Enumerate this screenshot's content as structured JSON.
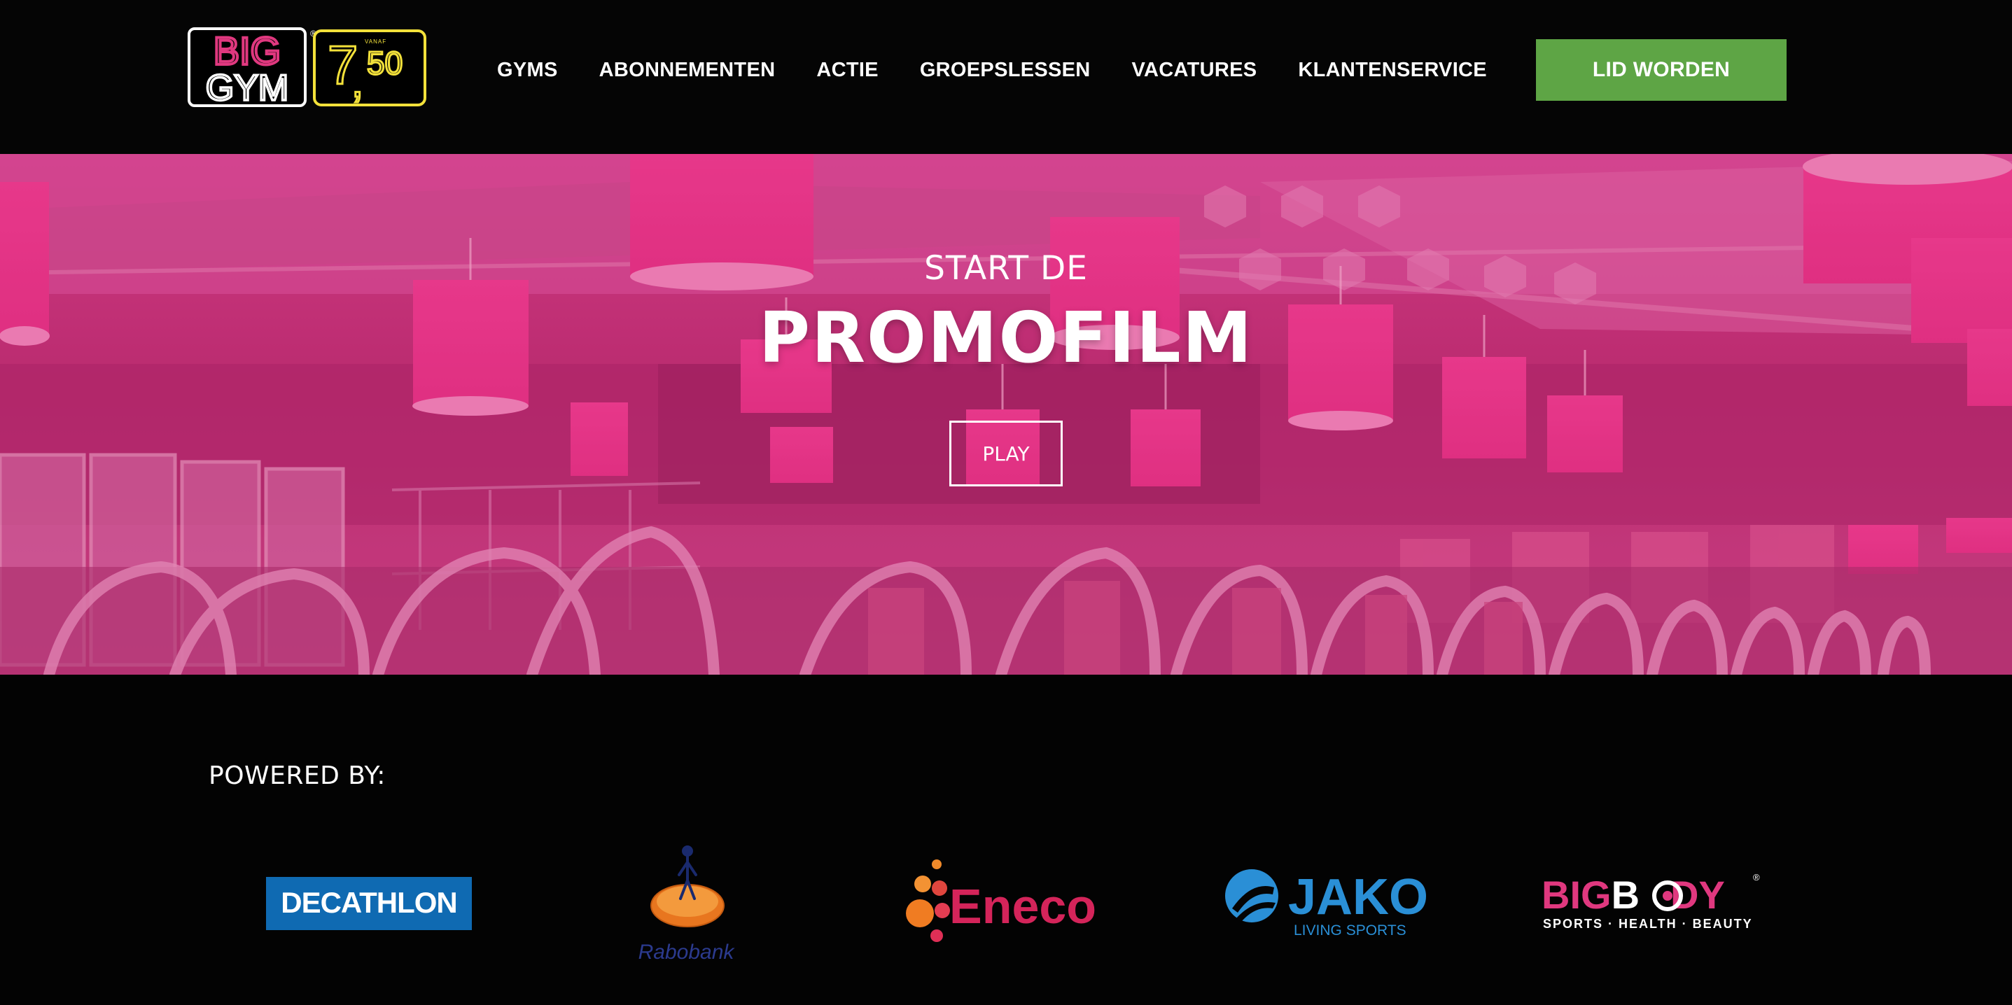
{
  "header": {
    "logo": {
      "brand_top": "BIG",
      "brand_bottom": "GYM",
      "registered": "®",
      "price_label": "VANAF",
      "price_main": "7",
      "price_sep": ",",
      "price_cents": "50"
    },
    "nav": [
      {
        "label": "GYMS"
      },
      {
        "label": "ABONNEMENTEN"
      },
      {
        "label": "ACTIE"
      },
      {
        "label": "GROEPSLESSEN"
      },
      {
        "label": "VACATURES"
      },
      {
        "label": "KLANTENSERVICE"
      }
    ],
    "cta_label": "LID WORDEN"
  },
  "hero": {
    "subtitle": "START DE",
    "title": "PROMOFILM",
    "play_label": "PLAY"
  },
  "sponsors": {
    "heading": "POWERED BY:",
    "decathlon": "DECATHLON",
    "rabobank": "Rabobank",
    "eneco": "Eneco",
    "jako": "JAKO",
    "jako_tagline": "LIVING SPORTS",
    "bigbody_a": "BIG",
    "bigbody_b": "B",
    "bigbody_c": "DY",
    "bigbody_tagline": "SPORTS · HEALTH · BEAUTY",
    "bigbody_registered": "®"
  },
  "colors": {
    "cta_green": "#5ea545",
    "brand_pink": "#e0387f",
    "price_yellow": "#f3e13a",
    "decathlon_blue": "#0f6ab2",
    "jako_blue": "#2a8fd6",
    "eneco_red": "#d4245a"
  }
}
